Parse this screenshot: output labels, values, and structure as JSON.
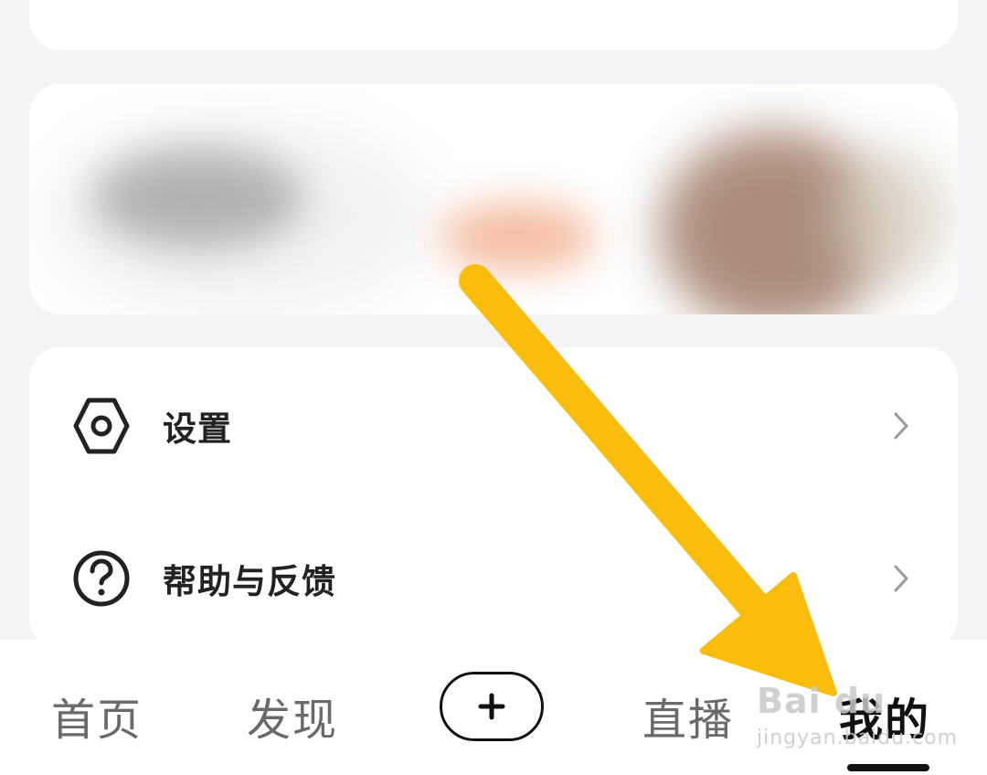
{
  "menu": {
    "items": [
      {
        "label": "设置",
        "icon": "settings-hexagon-icon"
      },
      {
        "label": "帮助与反馈",
        "icon": "help-circle-icon"
      }
    ]
  },
  "bottom_nav": {
    "items": [
      {
        "label": "首页"
      },
      {
        "label": "发现"
      },
      {
        "label": "直播"
      },
      {
        "label": "我的",
        "active": true
      }
    ],
    "center_icon": "plus-icon"
  },
  "watermark": {
    "brand": "Bai du",
    "sub": "jingyan.baidu.com"
  },
  "colors": {
    "arrow": "#fbbd0d",
    "background": "#f4f4f6",
    "card": "#ffffff",
    "text_primary": "#222222",
    "nav_inactive": "#6a6a6a"
  }
}
